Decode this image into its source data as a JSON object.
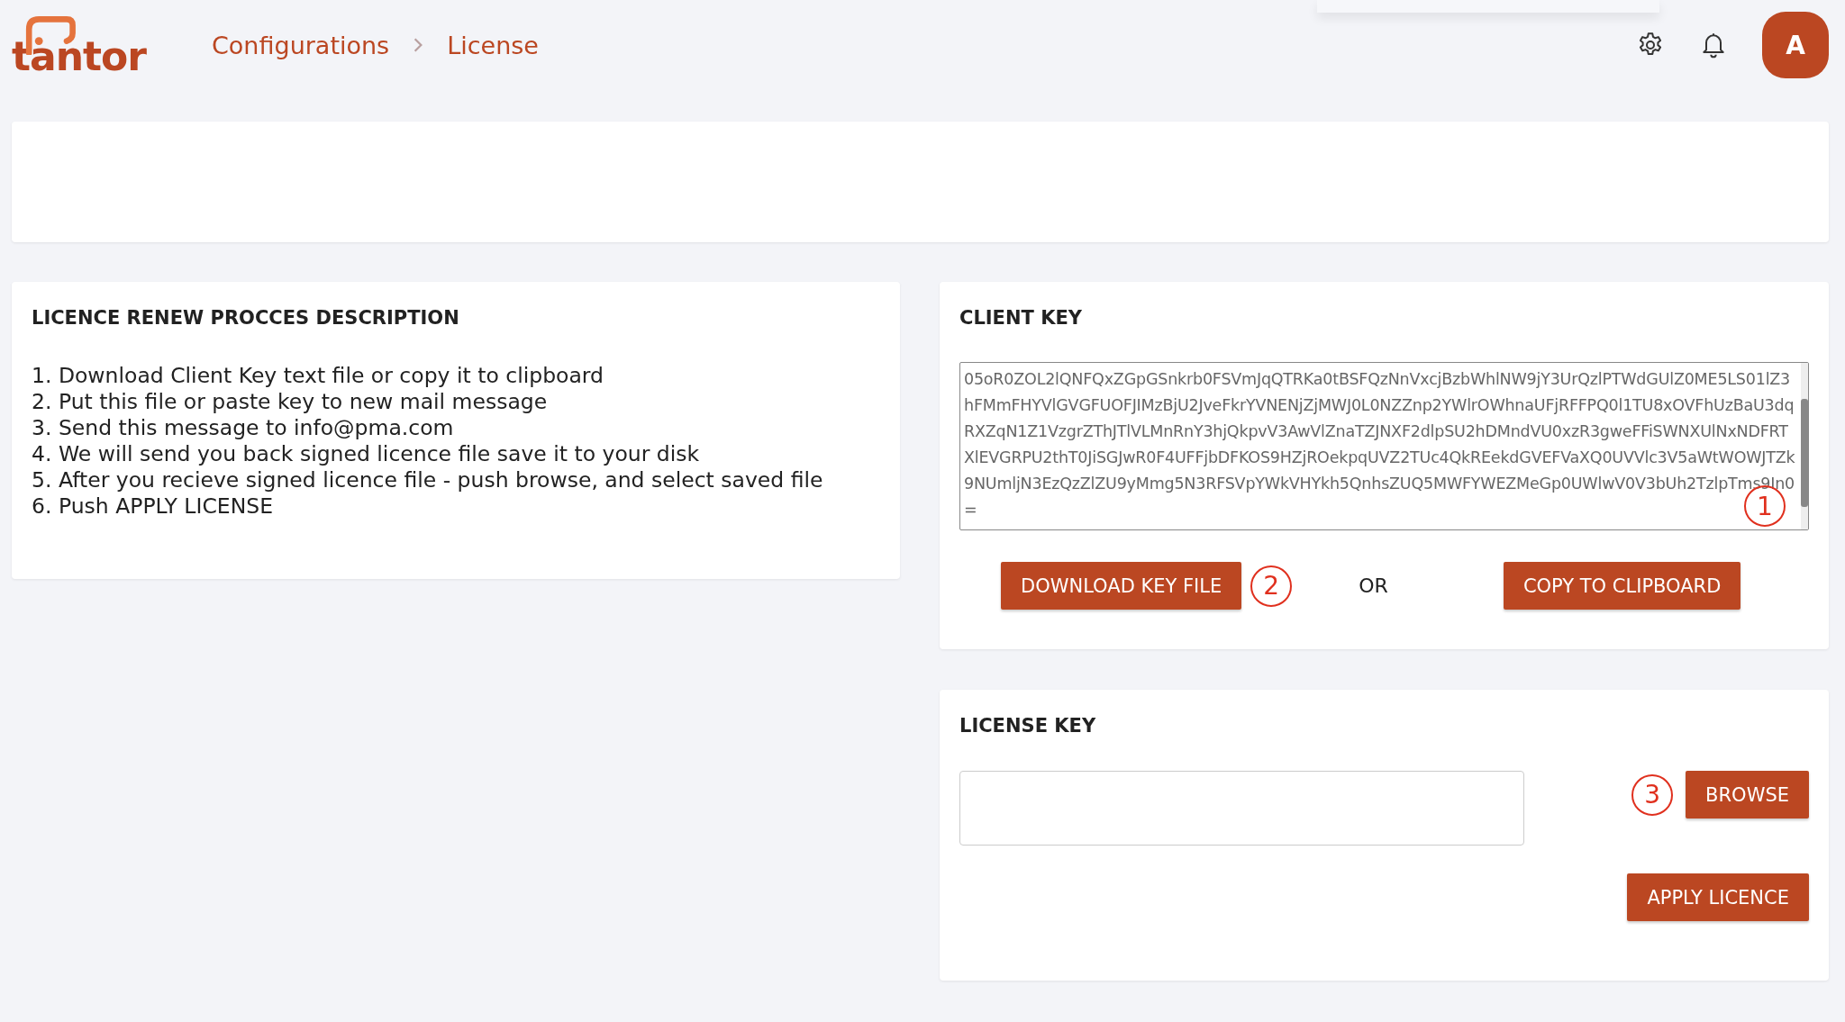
{
  "header": {
    "logo": "tantor",
    "breadcrumb": [
      "Configurations",
      "License"
    ],
    "avatar": "A"
  },
  "description": {
    "title": "LICENCE RENEW PROCCES DESCRIPTION",
    "steps": [
      "1. Download Client Key text file or copy it to clipboard",
      "2. Put this file or paste key to new mail message",
      "3. Send this message to info@pma.com",
      "4. We will send you back signed licence file save it to your disk",
      "5. After you recieve signed licence file - push browse, and select saved file",
      "6. Push APPLY LICENSE"
    ]
  },
  "client_key": {
    "title": "CLIENT KEY",
    "value": "05oR0ZOL2lQNFQxZGpGSnkrb0FSVmJqQTRKa0tBSFQzNnVxcjBzbWhlNW9jY3UrQzlPTWdGUlZ0ME5LS01lZ3hFMmFHYVlGVGFUOFJIMzBjU2JveFkrYVNENjZjMWJ0L0NZZnp2YWlrOWhnaUFjRFFPQ0l1TU8xOVFhUzBaU3dqRXZqN1Z1VzgrZThJTlVLMnRnY3hjQkpvV3AwVlZnaTZJNXF2dlpSU2hDMndVU0xzR3gweFFiSWNXUlNxNDFRTXlEVGRPU2thT0JiSGJwR0F4UFFjbDFKOS9HZjROekpqUVZ2TUc4QkREekdGVEFVaXQ0UVVlc3V5aWtWOWJTZk9NUmljN3EzQzZlZU9yMmg5N3RFSVpYWkVHYkh5QnhsZUQ5MWFYWEZMeGp0UWlwV0V3bUh2TzlpTms9In0=",
    "annotation": "1",
    "download_button": "DOWNLOAD KEY FILE",
    "download_annotation": "2",
    "or": "OR",
    "copy_button": "COPY TO CLIPBOARD"
  },
  "license_key": {
    "title": "LICENSE KEY",
    "browse_annotation": "3",
    "browse_button": "BROWSE",
    "apply_button": "APPLY LICENCE"
  }
}
